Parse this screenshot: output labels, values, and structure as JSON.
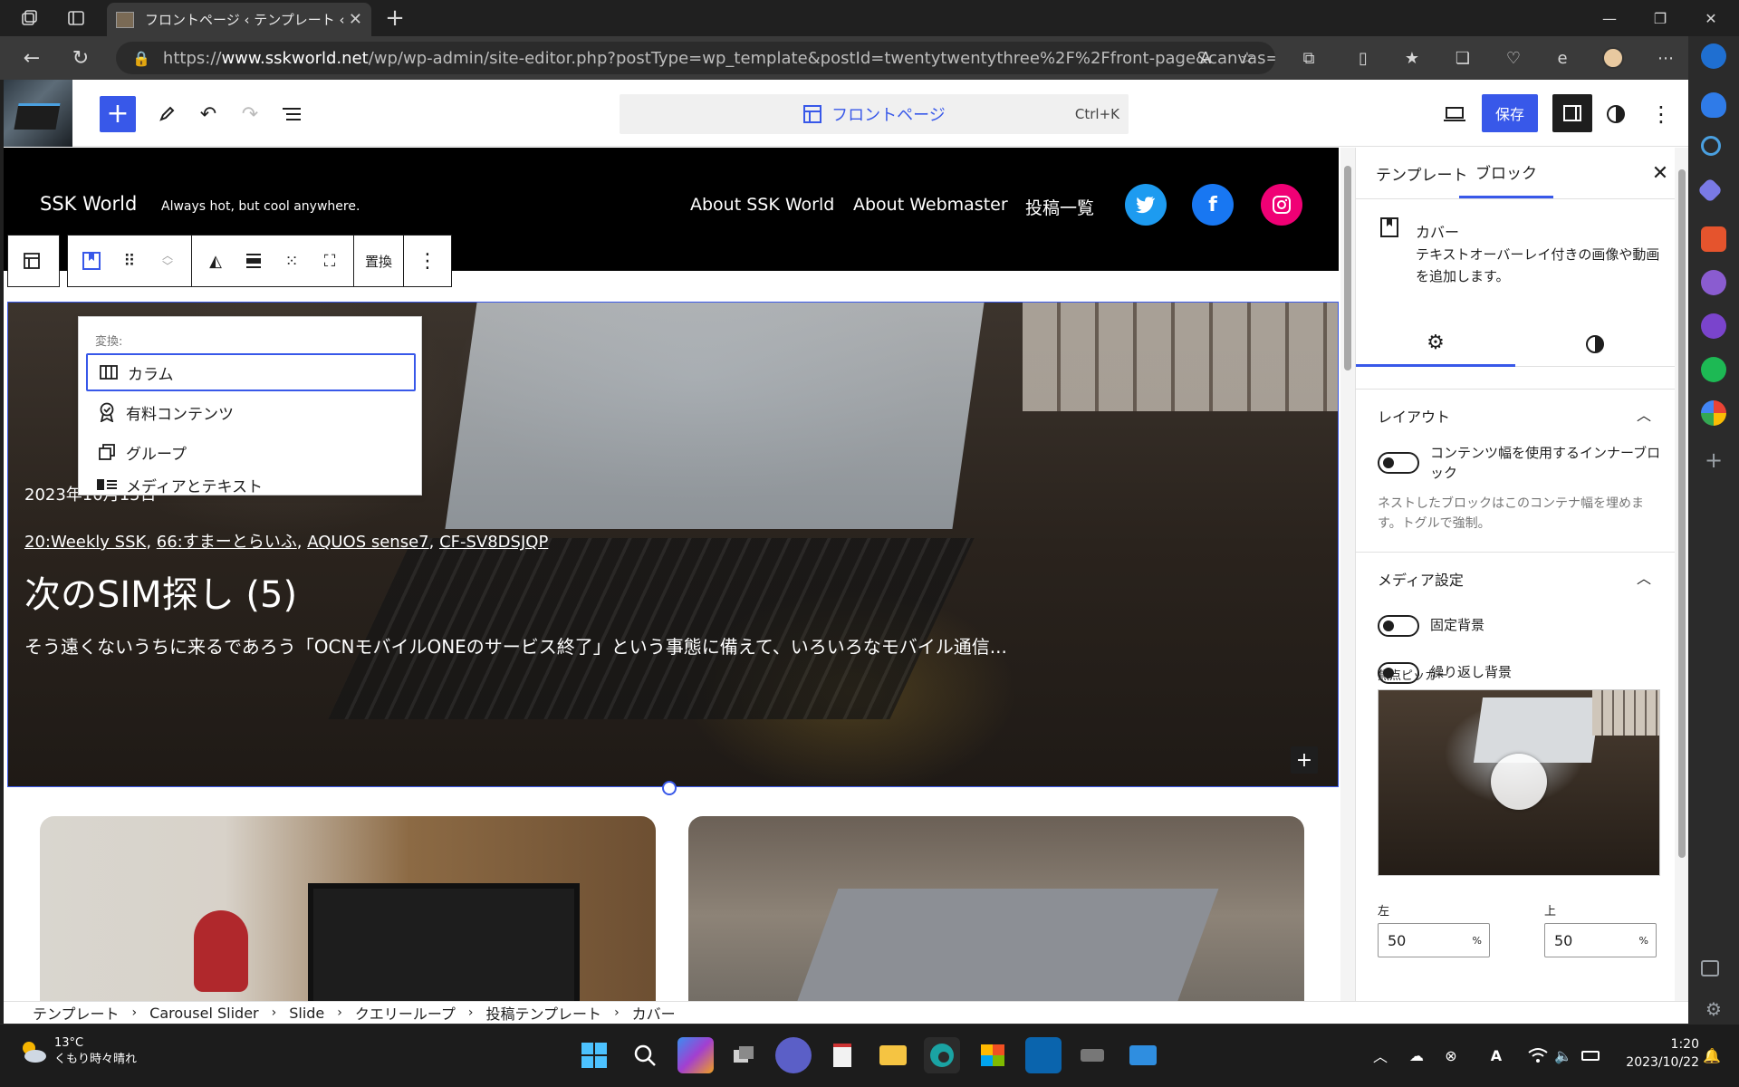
{
  "browser": {
    "tab_title": "フロントページ ‹ テンプレート ‹ エディタ",
    "url_prefix": "https://",
    "url_domain": "www.sskworld.net",
    "url_path": "/wp/wp-admin/site-editor.php?postType=wp_template&postId=twentytwentythree%2F%2Ffront-page&canvas=edit"
  },
  "editor": {
    "document_title": "フロントページ",
    "shortcut": "Ctrl+K",
    "save_label": "保存",
    "replace_label": "置換"
  },
  "site": {
    "title": "SSK World",
    "tagline": "Always hot, but cool anywhere.",
    "nav": [
      "About SSK World",
      "About Webmaster",
      "投稿一覧"
    ],
    "social_colors": {
      "twitter": "#1d9bf0",
      "facebook": "#1877f2",
      "instagram": "#f00075"
    }
  },
  "transform_menu": {
    "label": "変換:",
    "items": [
      "カラム",
      "有料コンテンツ",
      "グループ",
      "メディアとテキスト"
    ]
  },
  "cover": {
    "date": "2023年10月15日",
    "categories": [
      "20:Weekly SSK",
      "66:すまーとらいふ",
      "AQUOS sense7",
      "CF-SV8DSJQP"
    ],
    "title": "次のSIM探し (5)",
    "excerpt": "そう遠くないうちに来るであろう「OCNモバイルONEのサービス終了」という事態に備えて、いろいろなモバイル通信..."
  },
  "inspector": {
    "tab_template": "テンプレート",
    "tab_block": "ブロック",
    "block_name": "カバー",
    "block_desc": "テキストオーバーレイ付きの画像や動画を追加します。",
    "layout_title": "レイアウト",
    "inner_toggle": "コンテンツ幅を使用するインナーブロック",
    "inner_help": "ネストしたブロックはこのコンテナ幅を埋めます。トグルで強制。",
    "media_title": "メディア設定",
    "fixed_bg": "固定背景",
    "repeat_bg": "繰り返し背景",
    "focal_label": "焦点ピッカー",
    "left_label": "左",
    "top_label": "上",
    "left_value": "50",
    "top_value": "50",
    "unit": "%"
  },
  "breadcrumb": [
    "テンプレート",
    "Carousel Slider",
    "Slide",
    "クエリーループ",
    "投稿テンプレート",
    "カバー"
  ],
  "taskbar": {
    "temp": "13°C",
    "weather": "くもり時々晴れ",
    "time": "1:20",
    "date": "2023/10/22"
  },
  "colors": {
    "accent": "#3858e9"
  }
}
